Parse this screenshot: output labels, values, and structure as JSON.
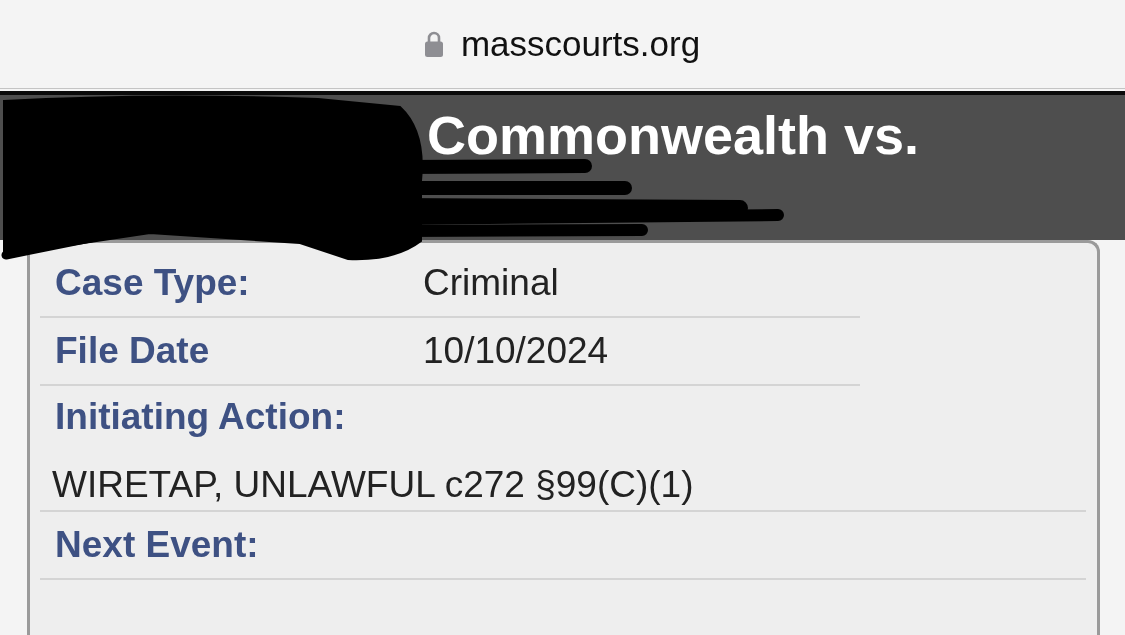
{
  "browser": {
    "address": "masscourts.org",
    "secure": true
  },
  "case_header": {
    "title": "Commonwealth vs."
  },
  "case_details": [
    {
      "kind": "inline",
      "label": "Case Type:",
      "value": "Criminal"
    },
    {
      "kind": "inline",
      "label": "File Date",
      "value": "10/10/2024"
    },
    {
      "kind": "stacked",
      "label": "Initiating Action:",
      "value": "WIRETAP, UNLAWFUL c272 §99(C)(1)"
    },
    {
      "kind": "stacked",
      "label": "Next Event:"
    }
  ]
}
